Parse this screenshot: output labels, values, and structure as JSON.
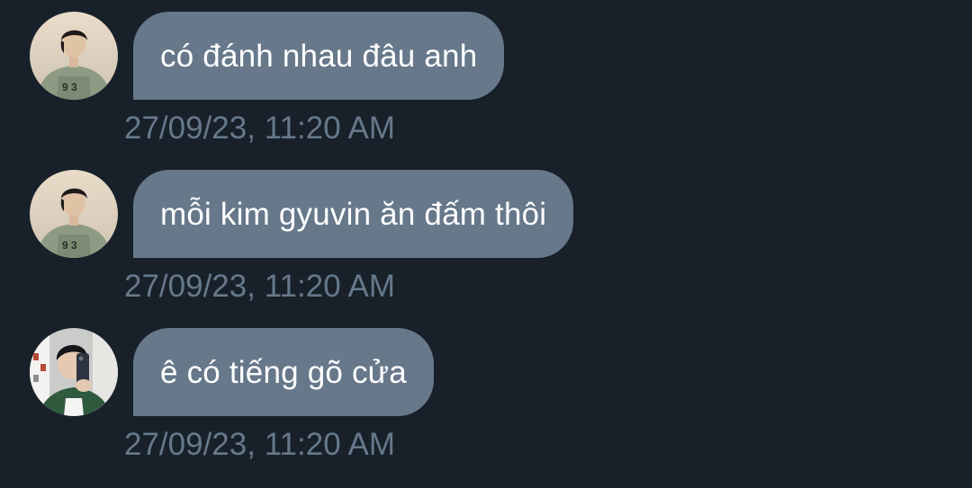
{
  "colors": {
    "background": "#18202a",
    "bubble": "#66788a",
    "bubble_text": "#ffffff",
    "timestamp": "#66788a"
  },
  "messages": [
    {
      "text": "có đánh nhau đâu anh",
      "timestamp": "27/09/23, 11:20 AM",
      "avatar_icon": "user-avatar-1-icon"
    },
    {
      "text": "mỗi kim gyuvin ăn đấm thôi",
      "timestamp": "27/09/23, 11:20 AM",
      "avatar_icon": "user-avatar-1-icon"
    },
    {
      "text": "ê có tiếng gõ cửa",
      "timestamp": "27/09/23, 11:20 AM",
      "avatar_icon": "user-avatar-2-icon"
    }
  ]
}
